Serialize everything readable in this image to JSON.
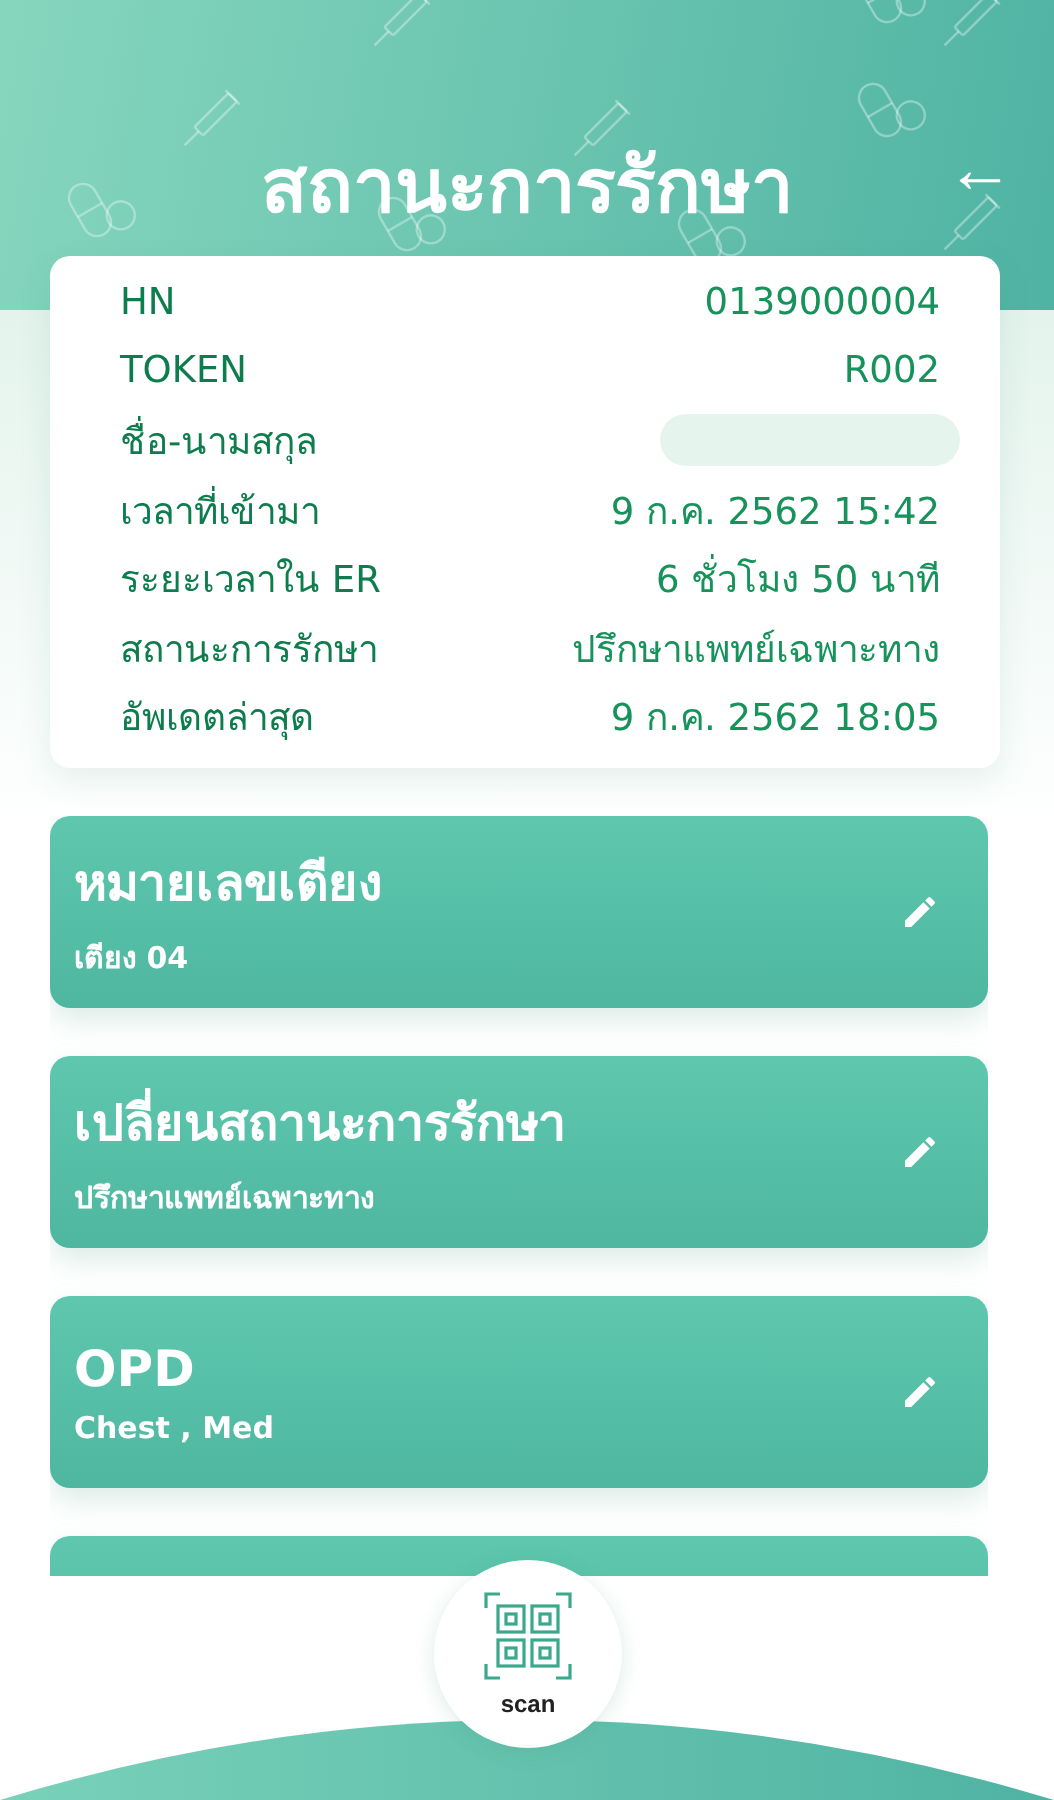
{
  "header": {
    "title": "สถานะการรักษา",
    "back_icon": "←"
  },
  "patient_info": [
    {
      "kind": "text",
      "label": "HN",
      "value": "0139000004"
    },
    {
      "kind": "text",
      "label": "TOKEN",
      "value": "R002"
    },
    {
      "kind": "hidden",
      "label": "ชื่อ-นามสกุล"
    },
    {
      "kind": "text",
      "label": "เวลาที่เข้ามา",
      "value": "9 ก.ค. 2562 15:42"
    },
    {
      "kind": "text",
      "label": "ระยะเวลาใน ER",
      "value": "6 ชั่วโมง 50 นาที"
    },
    {
      "kind": "text",
      "label": "สถานะการรักษา",
      "value": "ปรึกษาแพทย์เฉพาะทาง"
    },
    {
      "kind": "text",
      "label": "อัพเดตล่าสุด",
      "value": "9 ก.ค. 2562 18:05"
    }
  ],
  "actions": [
    {
      "kind": "action",
      "title": "หมายเลขเตียง",
      "subtitle": "เตียง 04"
    },
    {
      "kind": "action",
      "title": "เปลี่ยนสถานะการรักษา",
      "subtitle": "ปรึกษาแพทย์เฉพาะทาง"
    },
    {
      "kind": "action",
      "title": "OPD",
      "subtitle": "Chest , Med"
    },
    {
      "kind": "cut_off"
    }
  ],
  "scan_button": {
    "label": "scan"
  }
}
